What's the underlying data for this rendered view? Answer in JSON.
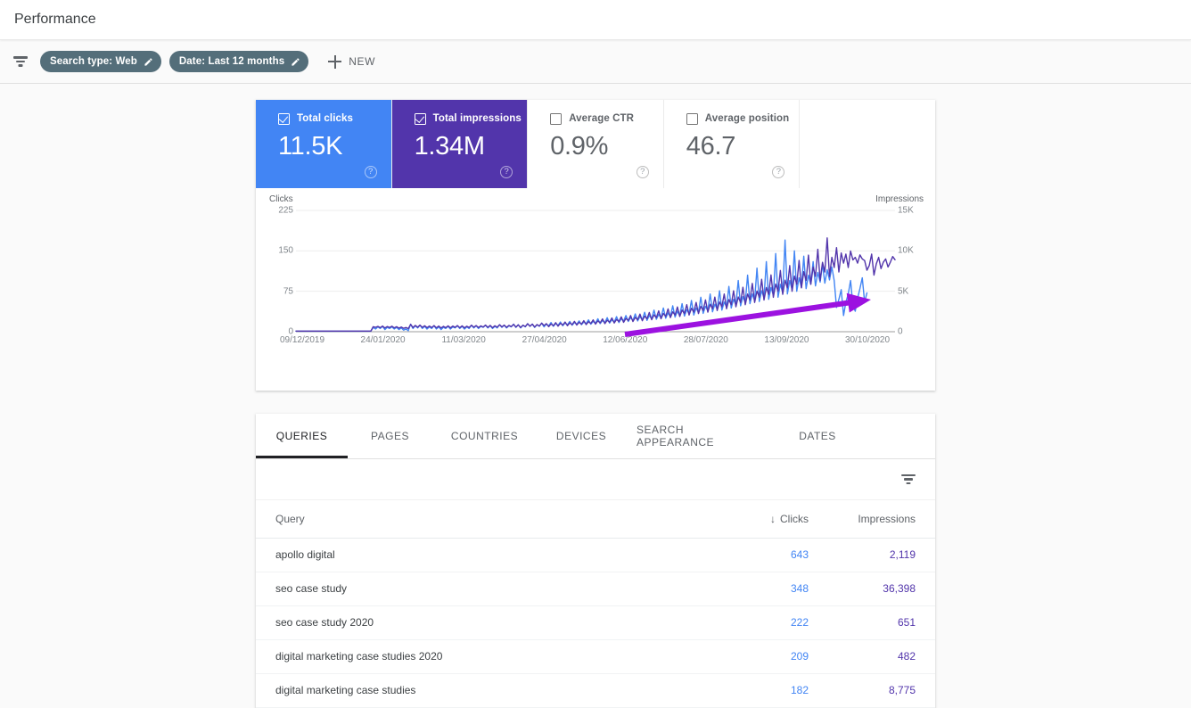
{
  "header": {
    "title": "Performance"
  },
  "filter_bar": {
    "filter_icon": "filter-funnel-icon",
    "chips": [
      {
        "label": "Search type: Web",
        "edit_icon": "pencil-icon"
      },
      {
        "label": "Date: Last 12 months",
        "edit_icon": "pencil-icon"
      }
    ],
    "new_button": {
      "label": "NEW",
      "icon": "plus-icon"
    }
  },
  "metrics": [
    {
      "label": "Total clicks",
      "value": "11.5K",
      "checked": true,
      "style": "sel-blue",
      "help": "?"
    },
    {
      "label": "Total impressions",
      "value": "1.34M",
      "checked": true,
      "style": "sel-purple",
      "help": "?"
    },
    {
      "label": "Average CTR",
      "value": "0.9%",
      "checked": false,
      "style": "off",
      "help": "?"
    },
    {
      "label": "Average position",
      "value": "46.7",
      "checked": false,
      "style": "off",
      "help": "?"
    }
  ],
  "colors": {
    "clicks": "#4285f4",
    "impressions": "#5235ab",
    "annotation_arrow": "#9c12e0",
    "chip": "#546e7a"
  },
  "chart_data": {
    "type": "line",
    "title": "",
    "left_axis": {
      "label": "Clicks",
      "ticks": [
        "0",
        "75",
        "150",
        "225"
      ],
      "ylim": [
        0,
        225
      ]
    },
    "right_axis": {
      "label": "Impressions",
      "ticks": [
        "0",
        "5K",
        "10K",
        "15K"
      ],
      "ylim": [
        0,
        15000
      ]
    },
    "xlabel": "",
    "grid": true,
    "legend_position": "none",
    "x_tick_labels": [
      "09/12/2019",
      "24/01/2020",
      "11/03/2020",
      "27/04/2020",
      "12/06/2020",
      "28/07/2020",
      "13/09/2020",
      "30/10/2020"
    ],
    "annotation": {
      "type": "arrow",
      "text": "",
      "color": "#9c12e0",
      "direction": "up-right"
    },
    "series": [
      {
        "name": "Clicks",
        "color": "#4285f4",
        "axis": "left",
        "values": [
          1,
          1,
          1,
          1,
          1,
          1,
          1,
          1,
          1,
          1,
          1,
          1,
          1,
          1,
          1,
          1,
          1,
          1,
          1,
          1,
          1,
          1,
          1,
          1,
          1,
          1,
          1,
          1,
          1,
          1,
          1,
          1,
          1,
          8,
          5,
          9,
          6,
          10,
          4,
          8,
          6,
          9,
          5,
          8,
          4,
          7,
          3,
          5,
          2,
          14,
          6,
          11,
          7,
          12,
          6,
          10,
          5,
          9,
          6,
          11,
          5,
          9,
          4,
          8,
          6,
          10,
          5,
          9,
          7,
          11,
          6,
          10,
          5,
          9,
          6,
          12,
          7,
          11,
          6,
          10,
          8,
          12,
          7,
          11,
          6,
          10,
          7,
          13,
          8,
          12,
          7,
          11,
          9,
          14,
          8,
          13,
          7,
          12,
          9,
          15,
          10,
          14,
          8,
          13,
          10,
          16,
          9,
          14,
          11,
          17,
          10,
          15,
          12,
          18,
          11,
          16,
          13,
          19,
          12,
          17,
          14,
          20,
          13,
          18,
          15,
          22,
          14,
          19,
          16,
          24,
          15,
          21,
          17,
          26,
          16,
          22,
          18,
          28,
          17,
          24,
          20,
          30,
          19,
          26,
          21,
          33,
          20,
          28,
          22,
          36,
          21,
          30,
          24,
          40,
          23,
          32,
          26,
          44,
          25,
          35,
          28,
          48,
          27,
          38,
          30,
          52,
          29,
          41,
          33,
          58,
          31,
          44,
          36,
          64,
          34,
          47,
          39,
          70,
          37,
          51,
          42,
          76,
          40,
          55,
          46,
          84,
          44,
          60,
          50,
          95,
          48,
          65,
          54,
          105,
          52,
          70,
          58,
          118,
          56,
          76,
          63,
          130,
          60,
          82,
          68,
          145,
          64,
          88,
          72,
          170,
          70,
          95,
          78,
          150,
          75,
          100,
          82,
          140,
          80,
          105,
          88,
          130,
          85,
          110,
          92,
          125,
          90,
          115,
          96,
          120,
          95,
          45,
          60,
          78,
          30,
          55,
          70,
          95,
          48,
          38,
          62,
          80,
          100,
          55,
          72
        ]
      },
      {
        "name": "Impressions",
        "color": "#5235ab",
        "axis": "right",
        "values": [
          80,
          80,
          80,
          80,
          80,
          80,
          80,
          80,
          80,
          80,
          80,
          80,
          80,
          80,
          80,
          80,
          80,
          80,
          80,
          80,
          80,
          80,
          80,
          80,
          80,
          80,
          80,
          80,
          80,
          80,
          80,
          80,
          80,
          620,
          540,
          660,
          500,
          700,
          460,
          640,
          520,
          680,
          480,
          620,
          440,
          580,
          420,
          520,
          380,
          900,
          520,
          780,
          560,
          820,
          540,
          740,
          500,
          700,
          520,
          760,
          480,
          700,
          460,
          660,
          500,
          720,
          480,
          700,
          540,
          760,
          500,
          720,
          480,
          680,
          520,
          800,
          560,
          760,
          520,
          720,
          580,
          820,
          540,
          780,
          500,
          740,
          560,
          860,
          600,
          820,
          540,
          780,
          640,
          900,
          580,
          840,
          520,
          800,
          640,
          980,
          680,
          940,
          580,
          880,
          700,
          1060,
          760,
          1000,
          620,
          960,
          740,
          1120,
          680,
          1040,
          820,
          1200,
          740,
          1100,
          880,
          1280,
          820,
          1160,
          940,
          1360,
          880,
          1240,
          1020,
          1460,
          940,
          1340,
          1100,
          1580,
          1000,
          1420,
          1180,
          1700,
          1080,
          1520,
          1260,
          1840,
          1160,
          1640,
          1380,
          2000,
          1260,
          1780,
          1480,
          2180,
          1360,
          1920,
          1600,
          2380,
          1480,
          2080,
          1740,
          2580,
          1600,
          2260,
          1880,
          2820,
          1740,
          2460,
          2060,
          3060,
          1880,
          2680,
          2240,
          3340,
          2060,
          2900,
          2420,
          3620,
          2240,
          3140,
          2620,
          3940,
          2420,
          3400,
          2840,
          4280,
          2620,
          3680,
          3080,
          4660,
          2840,
          3980,
          3340,
          5060,
          3080,
          4300,
          3620,
          5500,
          3340,
          4660,
          3920,
          5980,
          3620,
          5040,
          4260,
          6480,
          3920,
          5460,
          4620,
          7020,
          4260,
          5900,
          5000,
          7580,
          4620,
          6380,
          5420,
          8180,
          5000,
          6880,
          5860,
          8820,
          5420,
          7420,
          6340,
          9480,
          5860,
          8000,
          6840,
          10200,
          6340,
          8580,
          7380,
          11600,
          6840,
          9200,
          7940,
          10400,
          7380,
          9740,
          8480,
          9600,
          7940,
          9980,
          8880,
          9200,
          8480,
          9500,
          9000,
          8800,
          7600,
          8200,
          9600,
          7000,
          8400,
          9200,
          7800,
          8600,
          9000,
          8000,
          8600,
          9300,
          8900
        ]
      }
    ]
  },
  "table": {
    "tabs": [
      {
        "label": "QUERIES",
        "active": true
      },
      {
        "label": "PAGES",
        "active": false
      },
      {
        "label": "COUNTRIES",
        "active": false
      },
      {
        "label": "DEVICES",
        "active": false
      },
      {
        "label": "SEARCH APPEARANCE",
        "active": false
      },
      {
        "label": "DATES",
        "active": false
      }
    ],
    "toolbar": {
      "filter_icon": "filter-funnel-icon"
    },
    "columns": {
      "query": "Query",
      "clicks": "Clicks",
      "impressions": "Impressions",
      "sort_indicator": "↓"
    },
    "rows": [
      {
        "query": "apollo digital",
        "clicks": "643",
        "impressions": "2,119"
      },
      {
        "query": "seo case study",
        "clicks": "348",
        "impressions": "36,398"
      },
      {
        "query": "seo case study 2020",
        "clicks": "222",
        "impressions": "651"
      },
      {
        "query": "digital marketing case studies 2020",
        "clicks": "209",
        "impressions": "482"
      },
      {
        "query": "digital marketing case studies",
        "clicks": "182",
        "impressions": "8,775"
      }
    ]
  }
}
